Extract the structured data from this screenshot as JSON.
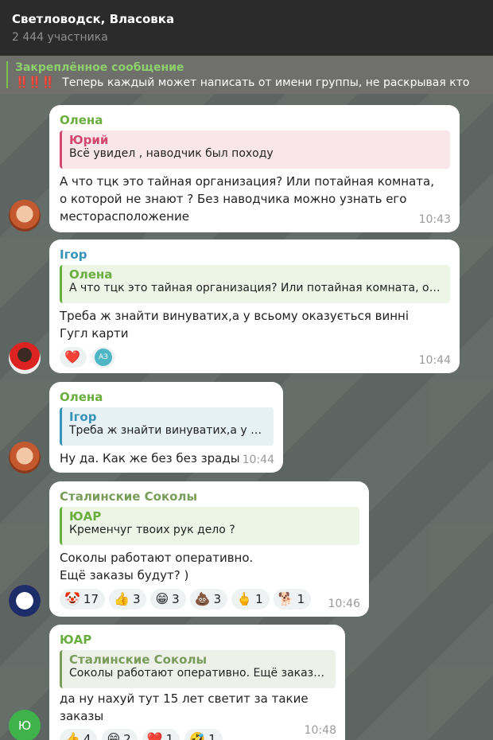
{
  "header": {
    "title": "Светловодск, Власовка",
    "subtitle": "2 444 участника"
  },
  "pinned": {
    "label": "Закреплённое сообщение",
    "bangs": "‼️‼️‼️",
    "text": "Теперь каждый может написать от имени группы, не раскрывая кто"
  },
  "messages": [
    {
      "sender": "Олена",
      "quote_name": "Юрий",
      "quote_text": "Всё увидел , наводчик был походу",
      "text": "А что тцк это тайная организация? Или потайная комната, о которой не знают ? Без наводчика можно узнать его месторасположение",
      "time": "10:43"
    },
    {
      "sender": "Ігор",
      "quote_name": "Олена",
      "quote_text": "А что тцк это тайная организация? Или потайная комната, о которой не знают ?",
      "text": "Треба ж знайти винуватих,а у всьому оказується винні Гугл карти",
      "reactions": [
        {
          "emoji": "❤️",
          "count": ""
        },
        {
          "emoji": "АЗ",
          "count": ""
        }
      ],
      "time": "10:44"
    },
    {
      "sender": "Олена",
      "quote_name": "Ігор",
      "quote_text": "Треба ж знайти винуватих,а у всьому оказується винні Гугл карти",
      "text": "Ну да. Как же без без зрады",
      "time": "10:44"
    },
    {
      "sender": "Сталинские Соколы",
      "quote_name": "ЮАР",
      "quote_text": "Кременчуг твоих рук дело ?",
      "text": "Соколы работают оперативно.\nЕщё заказы будут? )",
      "reactions": [
        {
          "emoji": "🤡",
          "count": "17"
        },
        {
          "emoji": "👍",
          "count": "3"
        },
        {
          "emoji": "😁",
          "count": "3"
        },
        {
          "emoji": "💩",
          "count": "3"
        },
        {
          "emoji": "🖕",
          "count": "1"
        },
        {
          "emoji": "🐕",
          "count": "1"
        }
      ],
      "time": "10:46"
    },
    {
      "sender": "ЮАР",
      "avatar_letter": "Ю",
      "quote_name": "Сталинские Соколы",
      "quote_text": "Соколы работают оперативно.  Ещё заказы будут? )",
      "text": "да ну нахуй тут 15 лет светит за такие заказы",
      "reactions": [
        {
          "emoji": "👍",
          "count": "4"
        },
        {
          "emoji": "😁",
          "count": "2"
        },
        {
          "emoji": "❤️",
          "count": "1"
        },
        {
          "emoji": "🤣",
          "count": "1"
        }
      ],
      "time": "10:48"
    }
  ]
}
